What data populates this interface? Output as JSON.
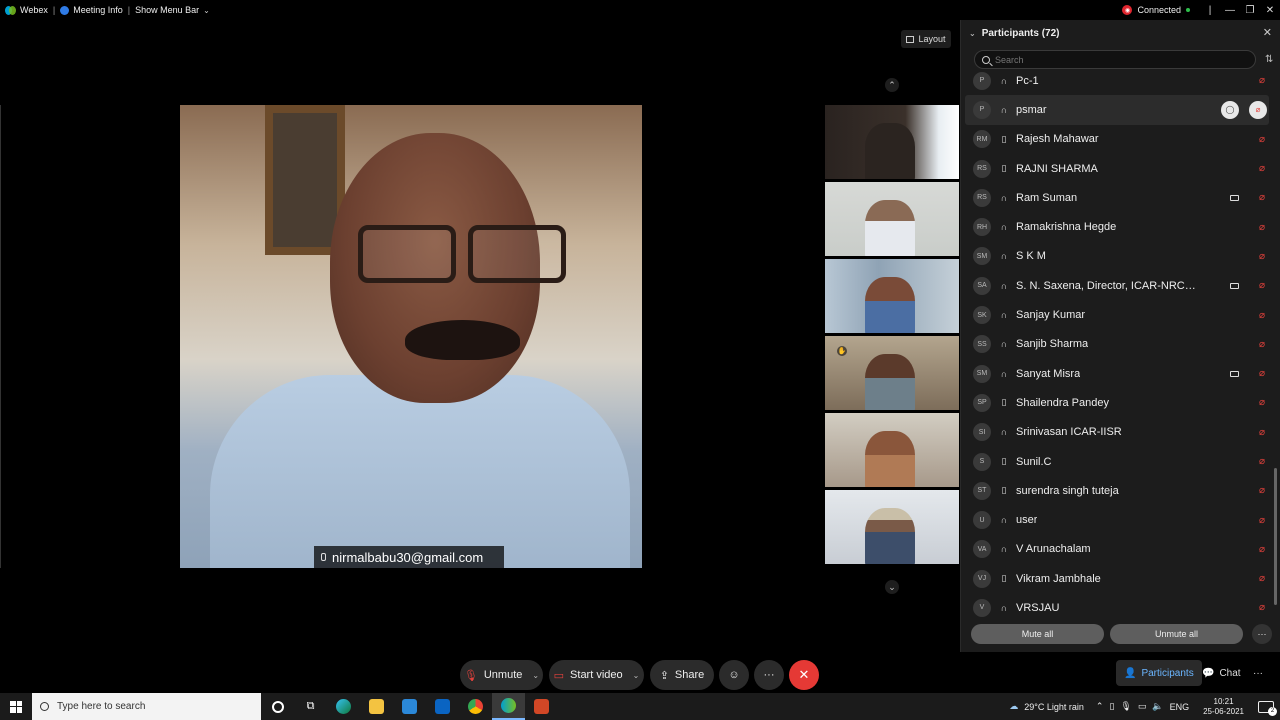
{
  "topbar": {
    "app_name": "Webex",
    "meeting_info": "Meeting Info",
    "show_menu_bar": "Show Menu Bar",
    "status": "Connected"
  },
  "layout_button": "Layout",
  "main_video": {
    "name_label": "nirmalbabu30@gmail.com"
  },
  "participants": {
    "title": "Participants (72)",
    "search_placeholder": "Search",
    "items": [
      {
        "initials": "P",
        "name": "Pc-1",
        "device": "headset",
        "video": false
      },
      {
        "initials": "P",
        "name": "psmar",
        "device": "headset",
        "video": false,
        "highlight": true
      },
      {
        "initials": "RM",
        "name": "Rajesh Mahawar",
        "device": "phone",
        "video": false
      },
      {
        "initials": "RS",
        "name": "RAJNI SHARMA",
        "device": "phone",
        "video": false
      },
      {
        "initials": "RS",
        "name": "Ram Suman",
        "device": "headset",
        "video": true
      },
      {
        "initials": "RH",
        "name": "Ramakrishna Hegde",
        "device": "headset",
        "video": false
      },
      {
        "initials": "SM",
        "name": "S K M",
        "device": "headset",
        "video": false
      },
      {
        "initials": "SA",
        "name": "S. N. Saxena, Director, ICAR-NRCSS, Aj...",
        "device": "headset",
        "video": true
      },
      {
        "initials": "SK",
        "name": "Sanjay Kumar",
        "device": "headset",
        "video": false
      },
      {
        "initials": "SS",
        "name": "Sanjib Sharma",
        "device": "headset",
        "video": false
      },
      {
        "initials": "SM",
        "name": "Sanyat Misra",
        "device": "headset",
        "video": true
      },
      {
        "initials": "SP",
        "name": "Shailendra Pandey",
        "device": "phone",
        "video": false
      },
      {
        "initials": "SI",
        "name": "Srinivasan ICAR-IISR",
        "device": "headset",
        "video": false
      },
      {
        "initials": "S",
        "name": "Sunil.C",
        "device": "phone",
        "video": false
      },
      {
        "initials": "ST",
        "name": "surendra singh tuteja",
        "device": "phone",
        "video": false
      },
      {
        "initials": "U",
        "name": "user",
        "device": "headset",
        "video": false
      },
      {
        "initials": "VA",
        "name": "V Arunachalam",
        "device": "headset",
        "video": false
      },
      {
        "initials": "VJ",
        "name": "Vikram Jambhale",
        "device": "phone",
        "video": false
      },
      {
        "initials": "V",
        "name": "VRSJAU",
        "device": "headset",
        "video": false
      }
    ],
    "mute_all": "Mute all",
    "unmute_all": "Unmute all"
  },
  "controls": {
    "unmute": "Unmute",
    "start_video": "Start video",
    "share": "Share",
    "participants_tab": "Participants",
    "chat_tab": "Chat"
  },
  "taskbar": {
    "search_placeholder": "Type here to search",
    "weather": "29°C  Light rain",
    "lang": "ENG",
    "time": "10:21",
    "date": "25-06-2021",
    "notifications": "2"
  },
  "colors": {
    "muted_red": "#e3413c",
    "end_red": "#e53935",
    "accent_blue": "#6bb6ff"
  }
}
